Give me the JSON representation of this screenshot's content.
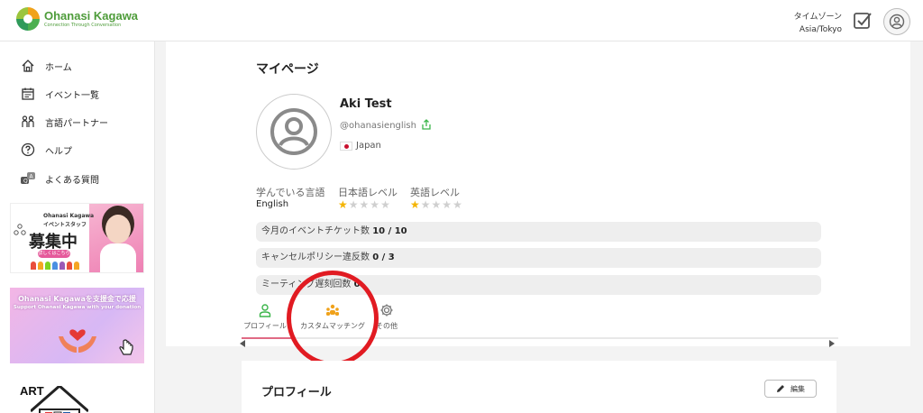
{
  "header": {
    "brand_title": "Ohanasi Kagawa",
    "brand_subtitle": "Connection Through Conversation",
    "timezone_label": "タイムゾーン",
    "timezone_value": "Asia/Tokyo",
    "icons": {
      "tasks": "checkbox-icon",
      "account": "user-circle-icon"
    }
  },
  "sidebar": {
    "items": [
      {
        "label": "ホーム",
        "icon": "home-icon"
      },
      {
        "label": "イベント一覧",
        "icon": "calendar-icon"
      },
      {
        "label": "言語パートナー",
        "icon": "people-icon"
      },
      {
        "label": "ヘルプ",
        "icon": "question-icon"
      },
      {
        "label": "よくある質問",
        "icon": "faq-icon"
      }
    ],
    "banner_staff": {
      "brand": "Ohanasi Kagawa",
      "subtitle": "イベントスタッフ",
      "headline": "募集中",
      "button": "詳しくはこちら"
    },
    "banner_donation": {
      "title": "Ohanasi Kagawaを支援金で応援",
      "subtitle": "Support Ohanasi Kagawa with your donation"
    },
    "art_label": "ART"
  },
  "mypage": {
    "title": "マイページ",
    "user": {
      "name": "Aki Test",
      "handle": "@ohanasienglish",
      "country": "Japan"
    },
    "levels": [
      {
        "label": "学んでいる言語",
        "value": "English"
      },
      {
        "label": "日本語レベル",
        "stars": 1,
        "max": 5
      },
      {
        "label": "英語レベル",
        "stars": 1,
        "max": 5
      }
    ],
    "stats": [
      {
        "label": "今月のイベントチケット数",
        "value": "10 / 10"
      },
      {
        "label": "キャンセルポリシー違反数",
        "value": "0 / 3"
      },
      {
        "label": "ミーティング遅刻回数",
        "value": "0"
      }
    ],
    "tabs": [
      {
        "label": "プロフィール",
        "icon": "person-icon",
        "active": true
      },
      {
        "label": "カスタムマッチング",
        "icon": "group-icon",
        "active": false
      },
      {
        "label": "その他",
        "icon": "gear-icon",
        "active": false
      }
    ]
  },
  "profile_section": {
    "title": "プロフィール",
    "edit_label": "編集"
  },
  "colors": {
    "brand_green": "#4e9c3a",
    "star_on": "#f4b400",
    "star_off": "#cfcfcf",
    "annotation_red": "#e11b22",
    "active_tab": "#e06a84",
    "share_green": "#3bb54a"
  }
}
